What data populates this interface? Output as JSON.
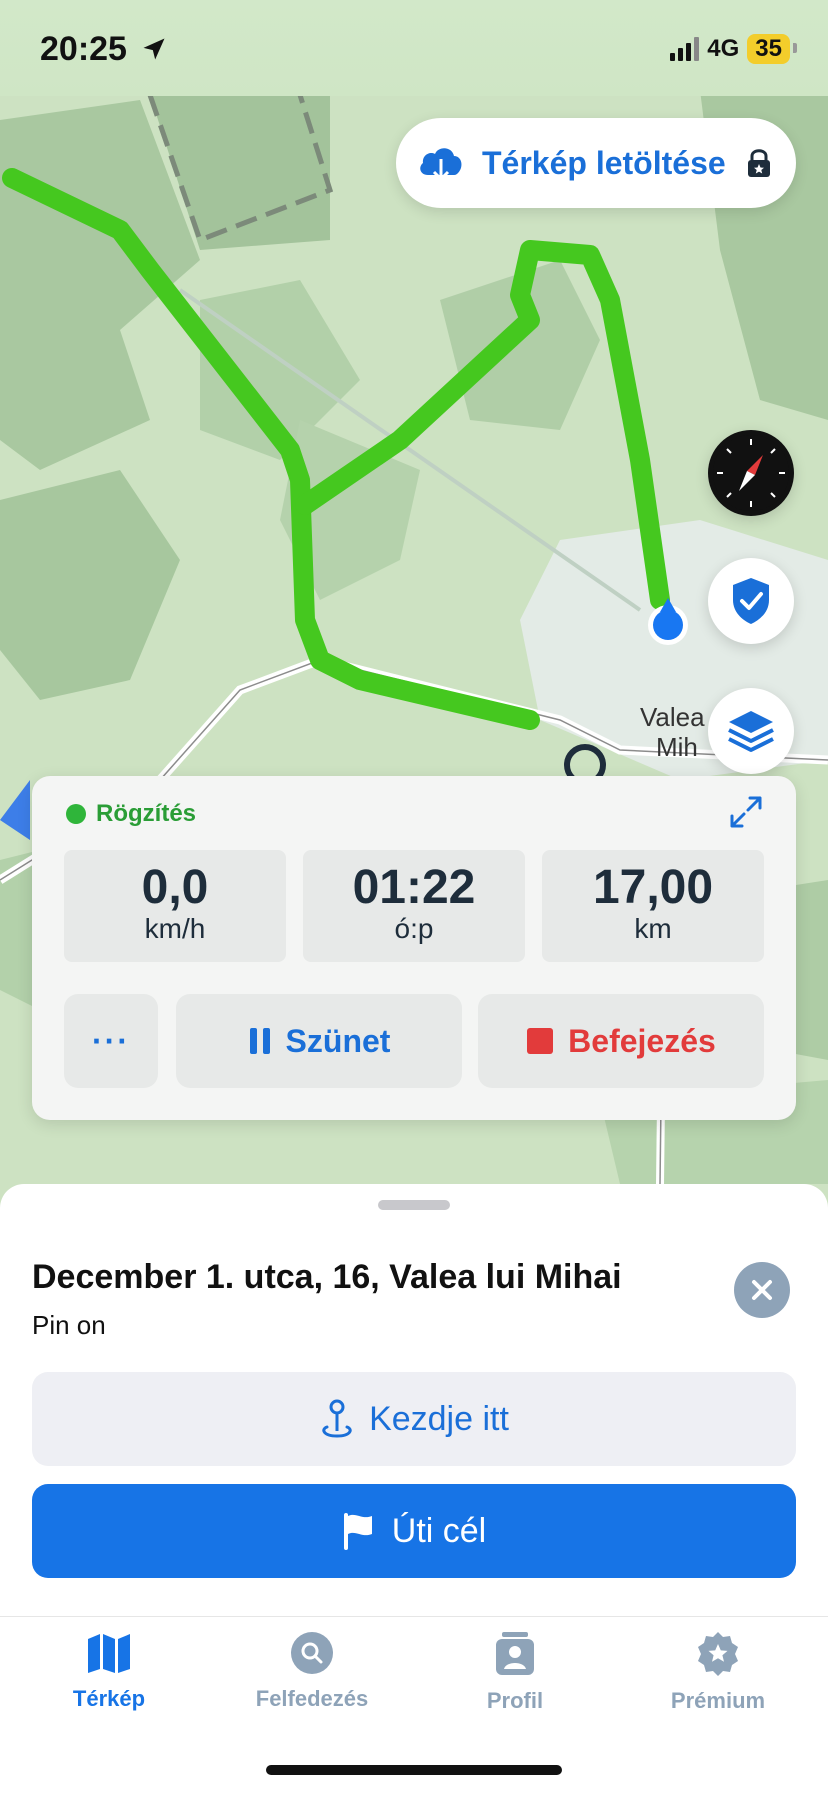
{
  "status_bar": {
    "time": "20:25",
    "network": "4G",
    "battery": "35"
  },
  "map": {
    "download_button_label": "Térkép letöltése",
    "place_label_line1": "Valea",
    "place_label_line2": "Mih",
    "route_color": "#45c81f",
    "location_color": "#1877f2"
  },
  "recording": {
    "status_label": "Rögzítés",
    "stats": [
      {
        "value": "0,0",
        "unit": "km/h"
      },
      {
        "value": "01:22",
        "unit": "ó:p"
      },
      {
        "value": "17,00",
        "unit": "km"
      }
    ],
    "more_label": "···",
    "pause_label": "Szünet",
    "finish_label": "Befejezés"
  },
  "sheet": {
    "title": "December 1. utca, 16, Valea lui Mihai",
    "subtitle": "Pin on",
    "start_label": "Kezdje itt",
    "destination_label": "Úti cél"
  },
  "tabs": [
    {
      "label": "Térkép",
      "icon": "map-icon",
      "active": true
    },
    {
      "label": "Felfedezés",
      "icon": "search-icon",
      "active": false
    },
    {
      "label": "Profil",
      "icon": "profile-icon",
      "active": false
    },
    {
      "label": "Prémium",
      "icon": "star-badge-icon",
      "active": false
    }
  ],
  "colors": {
    "accent": "#1774e6",
    "recording": "#2fb53a",
    "finish": "#e23b3b"
  }
}
